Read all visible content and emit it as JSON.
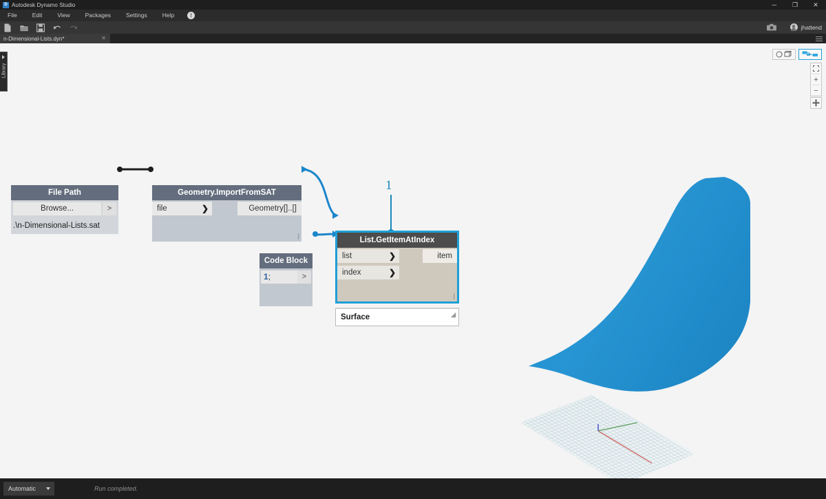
{
  "window": {
    "app_title": "Autodesk Dynamo Studio",
    "logo_letter": "D",
    "controls": {
      "minimize": "─",
      "maximize": "❐",
      "close": "✕"
    }
  },
  "menu": {
    "items": [
      "File",
      "Edit",
      "View",
      "Packages",
      "Settings",
      "Help"
    ],
    "info_icon": "!"
  },
  "toolbar": {
    "icons": [
      "new-file-icon",
      "open-folder-icon",
      "save-disk-icon",
      "undo-icon",
      "redo-icon"
    ],
    "camera_icon": "camera-icon",
    "username": "jhattend"
  },
  "tabs": {
    "document": {
      "label": "n-Dimensional-Lists.dyn*",
      "close": "✕"
    }
  },
  "library": {
    "label": "Library",
    "expand_icon": "chevron-right-icon"
  },
  "view_controls": {
    "geometry_toggle_icon": "geometry-view-icon",
    "graph_toggle_icon": "graph-view-icon",
    "fit_icon": "fit-to-screen-icon",
    "zoom_in": "+",
    "zoom_out": "−",
    "pan_icon": "pan-icon"
  },
  "nodes": [
    {
      "id": "file-path",
      "title": "File Path",
      "browse_label": "Browse...",
      "out_port": ">",
      "path_value": ".\\n-Dimensional-Lists.sat"
    },
    {
      "id": "geometry-import",
      "title": "Geometry.ImportFromSAT",
      "inputs": [
        "file"
      ],
      "outputs": [
        "Geometry[]..[]"
      ],
      "resize_glyph": "⌋"
    },
    {
      "id": "code-block",
      "title": "Code Block",
      "code_number": "1",
      "code_terminator": ";",
      "out_port": ">"
    },
    {
      "id": "list-getitematindex",
      "title": "List.GetItemAtIndex",
      "inputs": [
        "list",
        "index"
      ],
      "outputs": [
        "item"
      ],
      "resize_glyph": "⌋",
      "selected": true
    }
  ],
  "preview": {
    "value": "Surface",
    "resize_glyph": "◢"
  },
  "annotation": {
    "number": "1"
  },
  "status": {
    "run_mode": "Automatic",
    "message": "Run completed."
  },
  "colors": {
    "accent_blue": "#1e9fd8",
    "wire_blue": "#1b86ca",
    "surface_blue": "#2590ce",
    "node_header": "#636d7d",
    "selected_header": "#4c4c4c",
    "annotation": "#1787b8",
    "axis_x": "#d05a5a",
    "axis_y": "#5fa05f",
    "axis_z": "#5a5ad0"
  },
  "viewport": {
    "geometry_type": "surface",
    "grid": "ground-plane-grid"
  }
}
